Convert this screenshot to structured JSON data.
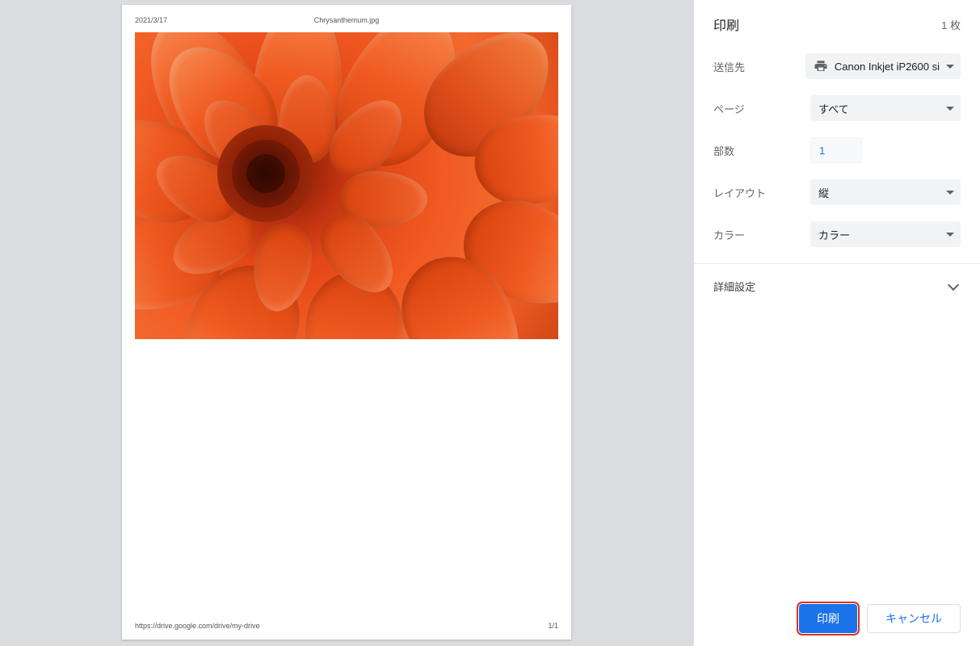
{
  "preview": {
    "date": "2021/3/17",
    "filename": "Chrysanthemum.jpg",
    "footer_url": "https://drive.google.com/drive/my-drive",
    "page_indicator": "1/1"
  },
  "panel": {
    "title": "印刷",
    "sheet_count": "1 枚",
    "destination": {
      "label": "送信先",
      "value": "Canon Inkjet iP2600 si"
    },
    "pages": {
      "label": "ページ",
      "value": "すべて"
    },
    "copies": {
      "label": "部数",
      "value": "1"
    },
    "layout": {
      "label": "レイアウト",
      "value": "縦"
    },
    "color": {
      "label": "カラー",
      "value": "カラー"
    },
    "more_settings": "詳細設定",
    "buttons": {
      "print": "印刷",
      "cancel": "キャンセル"
    }
  }
}
